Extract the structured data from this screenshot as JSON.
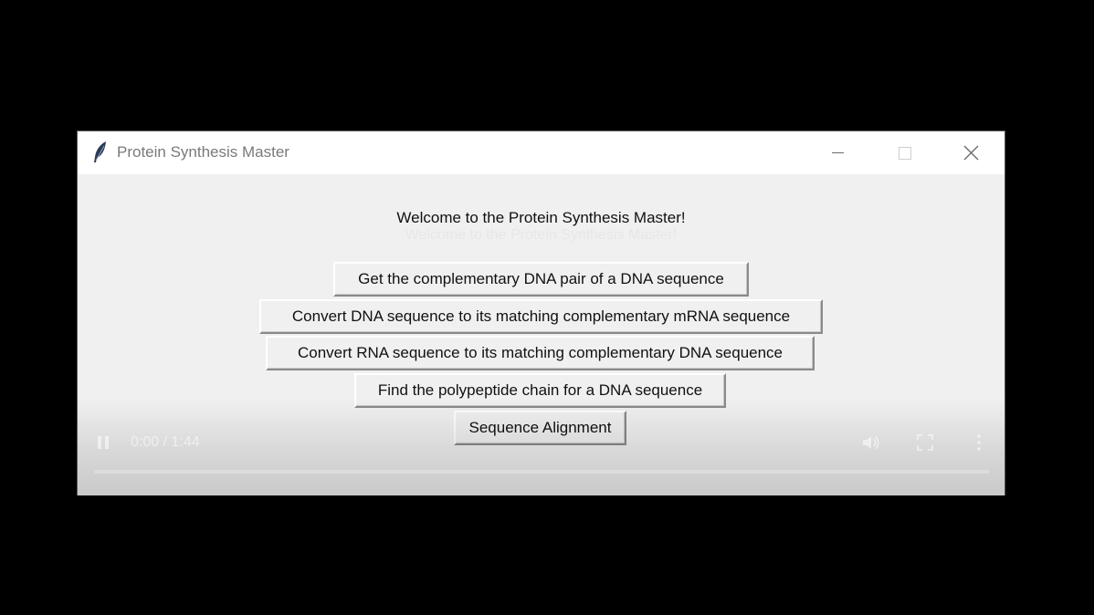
{
  "window": {
    "title": "Protein Synthesis Master",
    "icon": "feather-icon",
    "controls": [
      "minimize-icon",
      "maximize-icon",
      "close-icon"
    ]
  },
  "main": {
    "welcome": "Welcome to the Protein Synthesis Master!",
    "buttons": [
      "Get the complementary DNA pair of a DNA sequence",
      "Convert DNA sequence to its matching complementary mRNA sequence",
      "Convert RNA sequence to its matching complementary DNA sequence",
      "Find the polypeptide chain for a DNA sequence",
      "Sequence Alignment"
    ]
  },
  "video_player": {
    "time": "0:00 / 1:44",
    "progress": 0,
    "icons": [
      "pause-icon",
      "volume-icon",
      "fullscreen-icon",
      "more-options-icon"
    ]
  }
}
